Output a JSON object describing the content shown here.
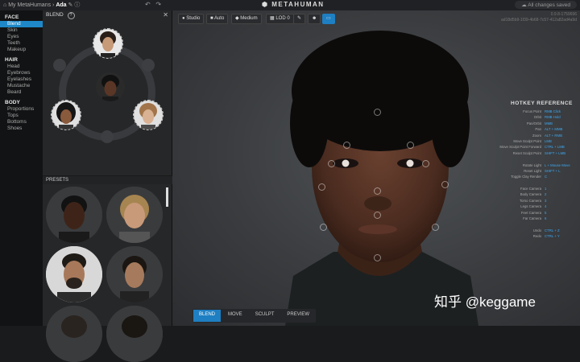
{
  "topbar": {
    "crumb_root": "My MetaHumans",
    "crumb_sep": "›",
    "crumb_name": "Ada",
    "undo_glyph": "↶",
    "redo_glyph": "↷",
    "brand": "METAHUMAN",
    "saved": "All changes saved"
  },
  "sidebar": {
    "face_header": "FACE",
    "face_items": [
      "Blend",
      "Skin",
      "Eyes",
      "Teeth",
      "Makeup"
    ],
    "hair_header": "HAIR",
    "hair_items": [
      "Head",
      "Eyebrows",
      "Eyelashes",
      "Mustache",
      "Beard"
    ],
    "body_header": "BODY",
    "body_items": [
      "Proportions",
      "Tops",
      "Bottoms",
      "Shoes"
    ]
  },
  "blend": {
    "title": "BLEND",
    "help": "?",
    "close": "✕",
    "presets_title": "PRESETS"
  },
  "viewport": {
    "toolbar": [
      "Studio",
      "Auto",
      "Medium",
      "LOD 0",
      "",
      "",
      ""
    ],
    "version_line1": "0.9.8-1759696",
    "version_line2": "ad18d5b9-1f39-4b68-7c57-412a82ad4a9d",
    "hotkey_title": "HOTKEY REFERENCE",
    "hotkeys": [
      {
        "action": "Focus Point",
        "key": "RMB Click"
      },
      {
        "action": "Orbit",
        "key": "RMB Hold"
      },
      {
        "action": "Pan/Orbit",
        "key": "MMB"
      },
      {
        "action": "Pan",
        "key": "ALT + MMB"
      },
      {
        "action": "Zoom",
        "key": "ALT + RMB"
      },
      {
        "action": "Move Sculpt Point",
        "key": "LMB"
      },
      {
        "action": "Move Sculpt Point Forward",
        "key": "CTRL + LMB"
      },
      {
        "action": "Reset Sculpt Point",
        "key": "SHIFT + LMB"
      },
      {
        "action": "",
        "key": ""
      },
      {
        "action": "Rotate Light",
        "key": "L + Mouse Move"
      },
      {
        "action": "Reset Light",
        "key": "SHIFT + L"
      },
      {
        "action": "Toggle Clay Render",
        "key": "C"
      },
      {
        "action": "",
        "key": ""
      },
      {
        "action": "Face Camera",
        "key": "1"
      },
      {
        "action": "Body Camera",
        "key": "2"
      },
      {
        "action": "Torso Camera",
        "key": "3"
      },
      {
        "action": "Legs Camera",
        "key": "4"
      },
      {
        "action": "Feet Camera",
        "key": "5"
      },
      {
        "action": "Far Camera",
        "key": "6"
      },
      {
        "action": "",
        "key": ""
      },
      {
        "action": "Undo",
        "key": "CTRL + Z"
      },
      {
        "action": "Redo",
        "key": "CTRL + Y"
      }
    ],
    "tabs": [
      "BLEND",
      "MOVE",
      "SCULPT",
      "PREVIEW"
    ],
    "watermark": "知乎 @keggame"
  }
}
